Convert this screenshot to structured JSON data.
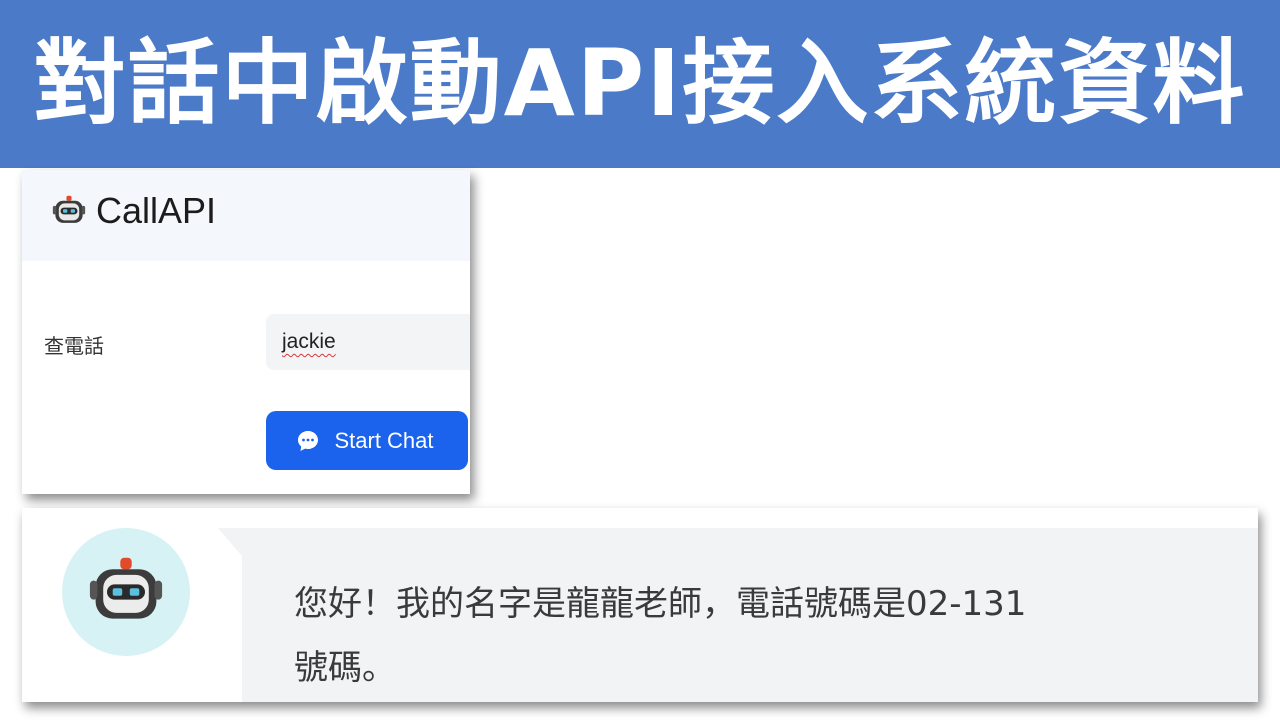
{
  "banner": {
    "title": "對話中啟動API接入系統資料"
  },
  "app": {
    "title": "CallAPI",
    "logo_icon": "robot-icon"
  },
  "form": {
    "label": "查電話",
    "input_value": "jackie",
    "button_label": "Start Chat",
    "button_icon": "chat-bubble-icon"
  },
  "chat": {
    "avatar_icon": "robot-icon",
    "message_lines": [
      "您好！我的名字是龍龍老師，電話號碼是02-131",
      "號碼。"
    ]
  },
  "colors": {
    "banner": "#4a7ac8",
    "button": "#1b63ec",
    "header_bg": "#f4f7fc",
    "avatar_bg": "#d7f2f4",
    "bubble_bg": "#f2f3f5"
  }
}
